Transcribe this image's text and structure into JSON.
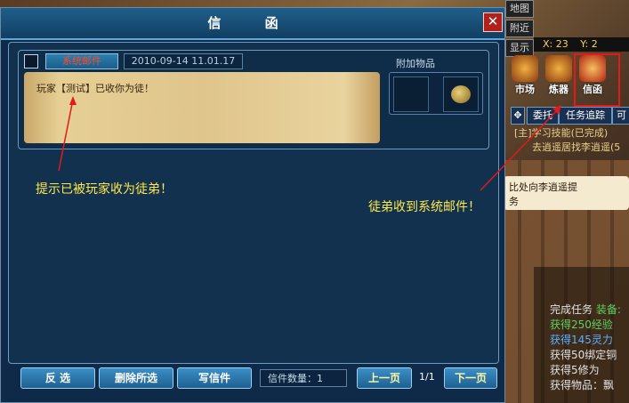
{
  "window": {
    "title": "信 函",
    "close_label": "✕"
  },
  "mail": {
    "sender_badge": "系统邮件",
    "date": "2010-09-14  11.01.17",
    "content": "玩家【测试】已收你为徒！",
    "attachments_label": "附加物品"
  },
  "annotations": {
    "left": "提示已被玩家收为徒弟！",
    "right": "徒弟收到系统邮件！"
  },
  "buttons": {
    "select_inverse": "反 选",
    "delete_selected": "删除所选",
    "write_mail": "写信件",
    "prev_page": "上一页",
    "next_page": "下一页"
  },
  "status": {
    "mail_count": "信件数量：1",
    "page": "1/1"
  },
  "side_panel": {
    "buttons": [
      "地图",
      "附近",
      "显示"
    ],
    "coord_x": "X: 23",
    "coord_y": "Y: 2",
    "func_icons": [
      "市场",
      "炼器",
      "信函"
    ],
    "task_tabs": [
      "委托",
      "任务追踪",
      "可"
    ],
    "task_line1": "[主]学习技能(已完成)",
    "task_line2": "去逍遥居找李逍遥(5",
    "tooltip": "比处向李逍遥提",
    "tooltip2": "务",
    "reward_title": "完成任务",
    "reward_equip": "装备:",
    "reward_exp": "获得250经验",
    "reward_spirit": "获得145灵力",
    "reward_bind_copper": "获得50绑定铜",
    "reward_cultivation": "获得5修为",
    "reward_items": "获得物品：飘"
  },
  "colors": {
    "accent": "#1f5f8a",
    "annotation": "#ffe84a",
    "highlight": "#e21a1a"
  }
}
